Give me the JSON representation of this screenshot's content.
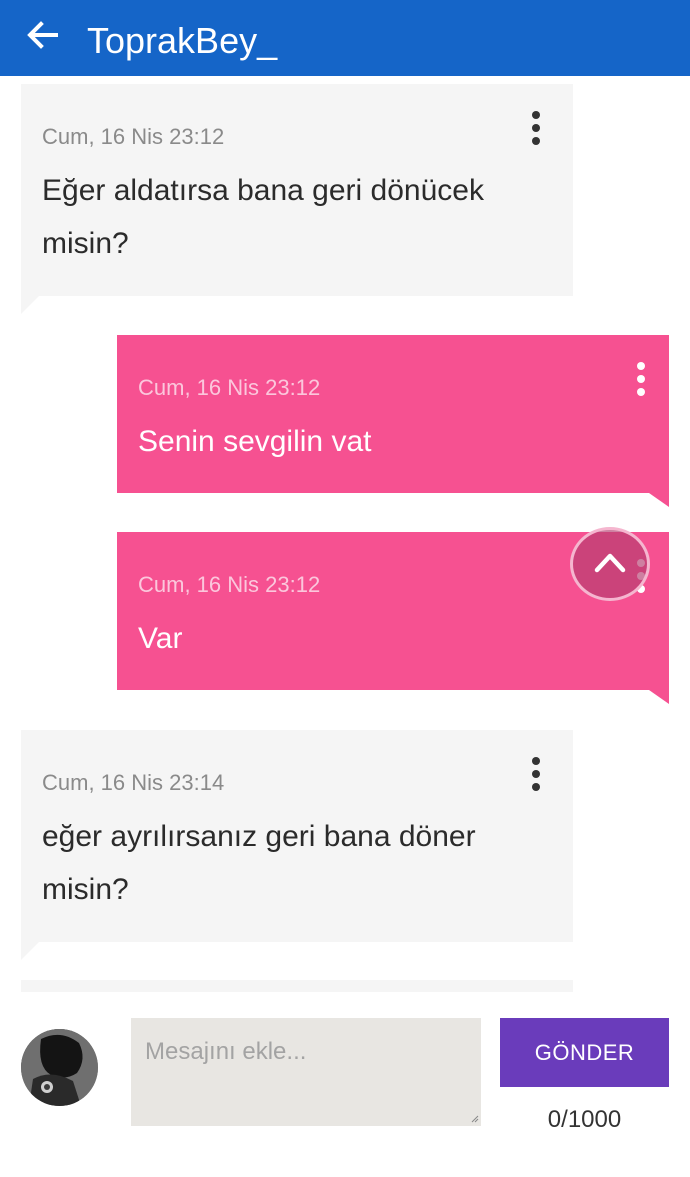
{
  "header": {
    "title": "ToprakBey_",
    "back_icon": "arrow-left-icon"
  },
  "messages": [
    {
      "direction": "received",
      "timestamp": "Cum, 16 Nis 23:12",
      "text_lines": [
        "Eğer aldatırsa bana geri dönücek",
        "misin?"
      ]
    },
    {
      "direction": "sent",
      "timestamp": "Cum, 16 Nis 23:12",
      "text_lines": [
        "Senin sevgilin vat"
      ]
    },
    {
      "direction": "sent",
      "timestamp": "Cum, 16 Nis 23:12",
      "text_lines": [
        "Var"
      ]
    },
    {
      "direction": "received",
      "timestamp": "Cum, 16 Nis 23:14",
      "text_lines": [
        "eğer ayrılırsanız geri bana döner",
        "misin?"
      ]
    }
  ],
  "composer": {
    "placeholder": "Mesajını ekle...",
    "value": "",
    "send_label": "GÖNDER",
    "counter": "0/1000"
  },
  "icons": {
    "more": "more-vertical-icon",
    "scroll_up": "chevron-up-icon"
  },
  "colors": {
    "app_bar": "#1565c8",
    "sent_bubble": "#f65191",
    "received_bubble": "#f5f5f5",
    "send_button": "#6a3cbb"
  }
}
